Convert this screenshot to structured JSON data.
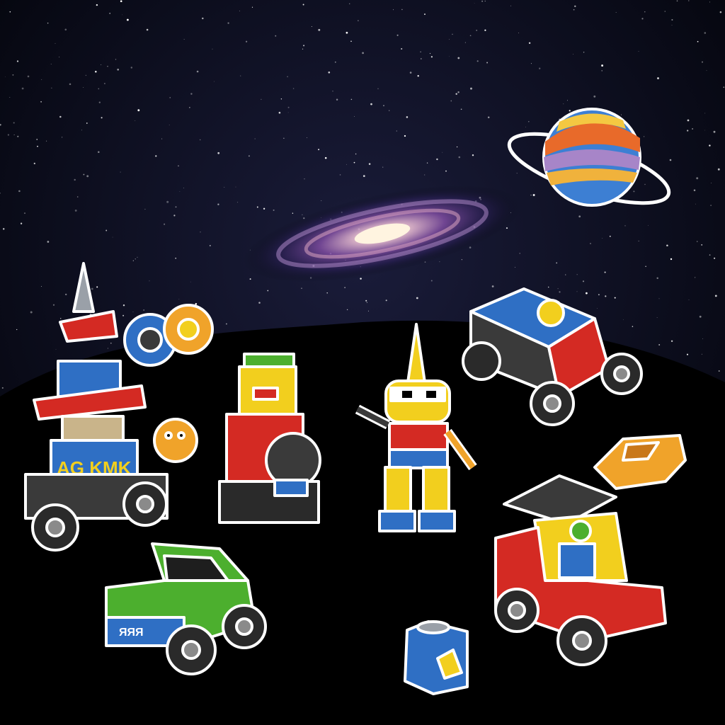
{
  "colors": {
    "space": "#05060f",
    "ground": "#000000",
    "outline": "#ffffff",
    "red": "#d42a23",
    "blue": "#2f6fc4",
    "yellow": "#f2cf1e",
    "green": "#4caf2e",
    "orange": "#f0a32a",
    "dark": "#3a3a3a"
  },
  "tower": {
    "sign_text": "AG KMK"
  },
  "truck": {
    "plate_text": "ЯЯЯ"
  }
}
